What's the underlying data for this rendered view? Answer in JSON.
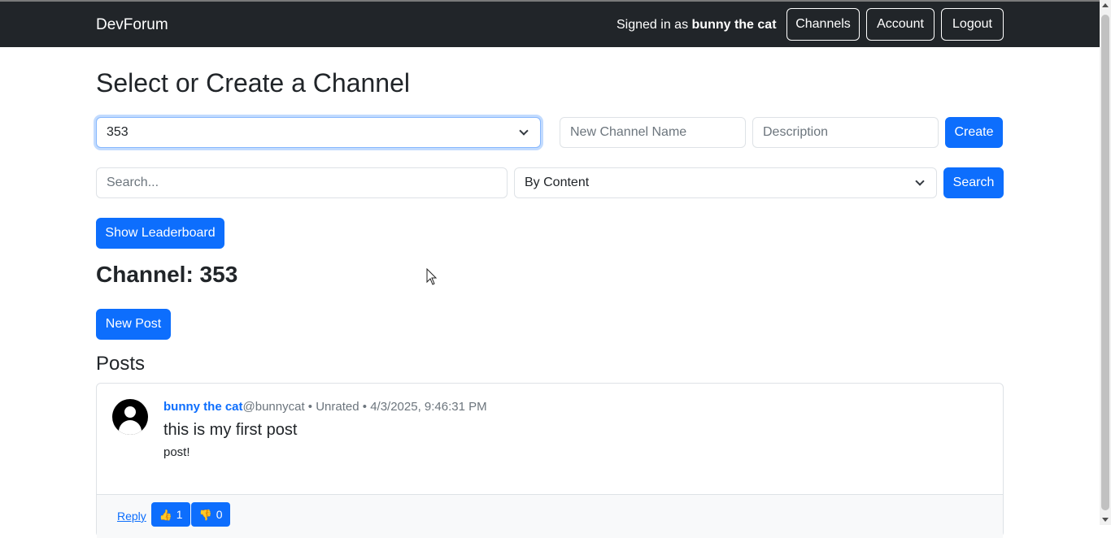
{
  "navbar": {
    "brand": "DevForum",
    "signed_in_prefix": "Signed in as ",
    "username": "bunny the cat",
    "channels_label": "Channels",
    "account_label": "Account",
    "logout_label": "Logout"
  },
  "page": {
    "title": "Select or Create a Channel"
  },
  "create_channel": {
    "selected_channel": "353",
    "name_placeholder": "New Channel Name",
    "description_placeholder": "Description",
    "create_label": "Create"
  },
  "search": {
    "placeholder": "Search...",
    "mode_selected": "By Content",
    "search_label": "Search"
  },
  "leaderboard_label": "Show Leaderboard",
  "channel": {
    "heading": "Channel: 353",
    "new_post_label": "New Post"
  },
  "posts": {
    "heading": "Posts",
    "items": [
      {
        "author": "bunny the cat",
        "handle": "@bunnycat",
        "rating": "Unrated",
        "timestamp": "4/3/2025, 9:46:31 PM",
        "separator": " • ",
        "title": "this is my first post",
        "body": "post!",
        "reply_label": "Reply",
        "likes": "1",
        "dislikes": "0"
      }
    ]
  },
  "colors": {
    "primary": "#0d6efd",
    "navbar": "#212529"
  },
  "icons": {
    "avatar": "user-circle-icon",
    "like": "thumbs-up-icon",
    "dislike": "thumbs-down-icon",
    "dropdown": "chevron-down-icon"
  }
}
